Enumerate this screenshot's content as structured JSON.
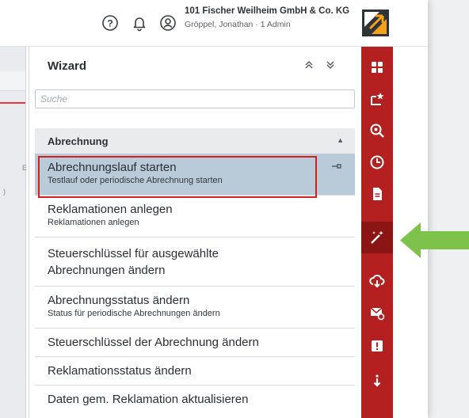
{
  "header": {
    "company": "101 Fischer Weilheim GmbH & Co. KG",
    "user": "Gröppel, Jonathan · 1 Admin",
    "icons": [
      "help-icon",
      "bell-icon",
      "user-circle-icon",
      "logo-icon"
    ]
  },
  "wizard": {
    "title": "Wizard",
    "search_placeholder": "Suche",
    "group": {
      "label": "Abrechnung",
      "state": "expanded"
    },
    "items": [
      {
        "title": "Abrechnungslauf starten",
        "subtitle": "Testlauf oder periodische Abrechnung starten",
        "selected": true
      },
      {
        "title": "Reklamationen anlegen",
        "subtitle": "Reklamationen anlegen"
      },
      {
        "title": "Steuerschlüssel für ausgewählte Abrechnungen ändern",
        "subtitle": ""
      },
      {
        "title": "Abrechnungsstatus ändern",
        "subtitle": "Status für periodische Abrechnungen ändern"
      },
      {
        "title": "Steuerschlüssel der Abrechnung ändern",
        "subtitle": ""
      },
      {
        "title": "Reklamationsstatus ändern",
        "subtitle": ""
      },
      {
        "title": "Daten gem. Reklamation aktualisieren",
        "subtitle": ""
      }
    ]
  },
  "left_partial": {
    "char1": "E",
    "char2": ")"
  },
  "sidebar": {
    "icons": [
      "grid-icon",
      "star-window-icon",
      "zoom-icon",
      "clock-icon",
      "document-icon",
      "wizard-wand-icon",
      "cloud-download-icon",
      "mail-settings-icon",
      "alert-icon",
      "download-more-icon"
    ],
    "active": "wizard-wand-icon"
  },
  "colors": {
    "sidebar_red": "#b41f1f",
    "sidebar_active": "#8b1414",
    "selected_row": "#b9cad8",
    "highlight_border": "#d31f1f",
    "annotation_arrow": "#7dc24a"
  }
}
